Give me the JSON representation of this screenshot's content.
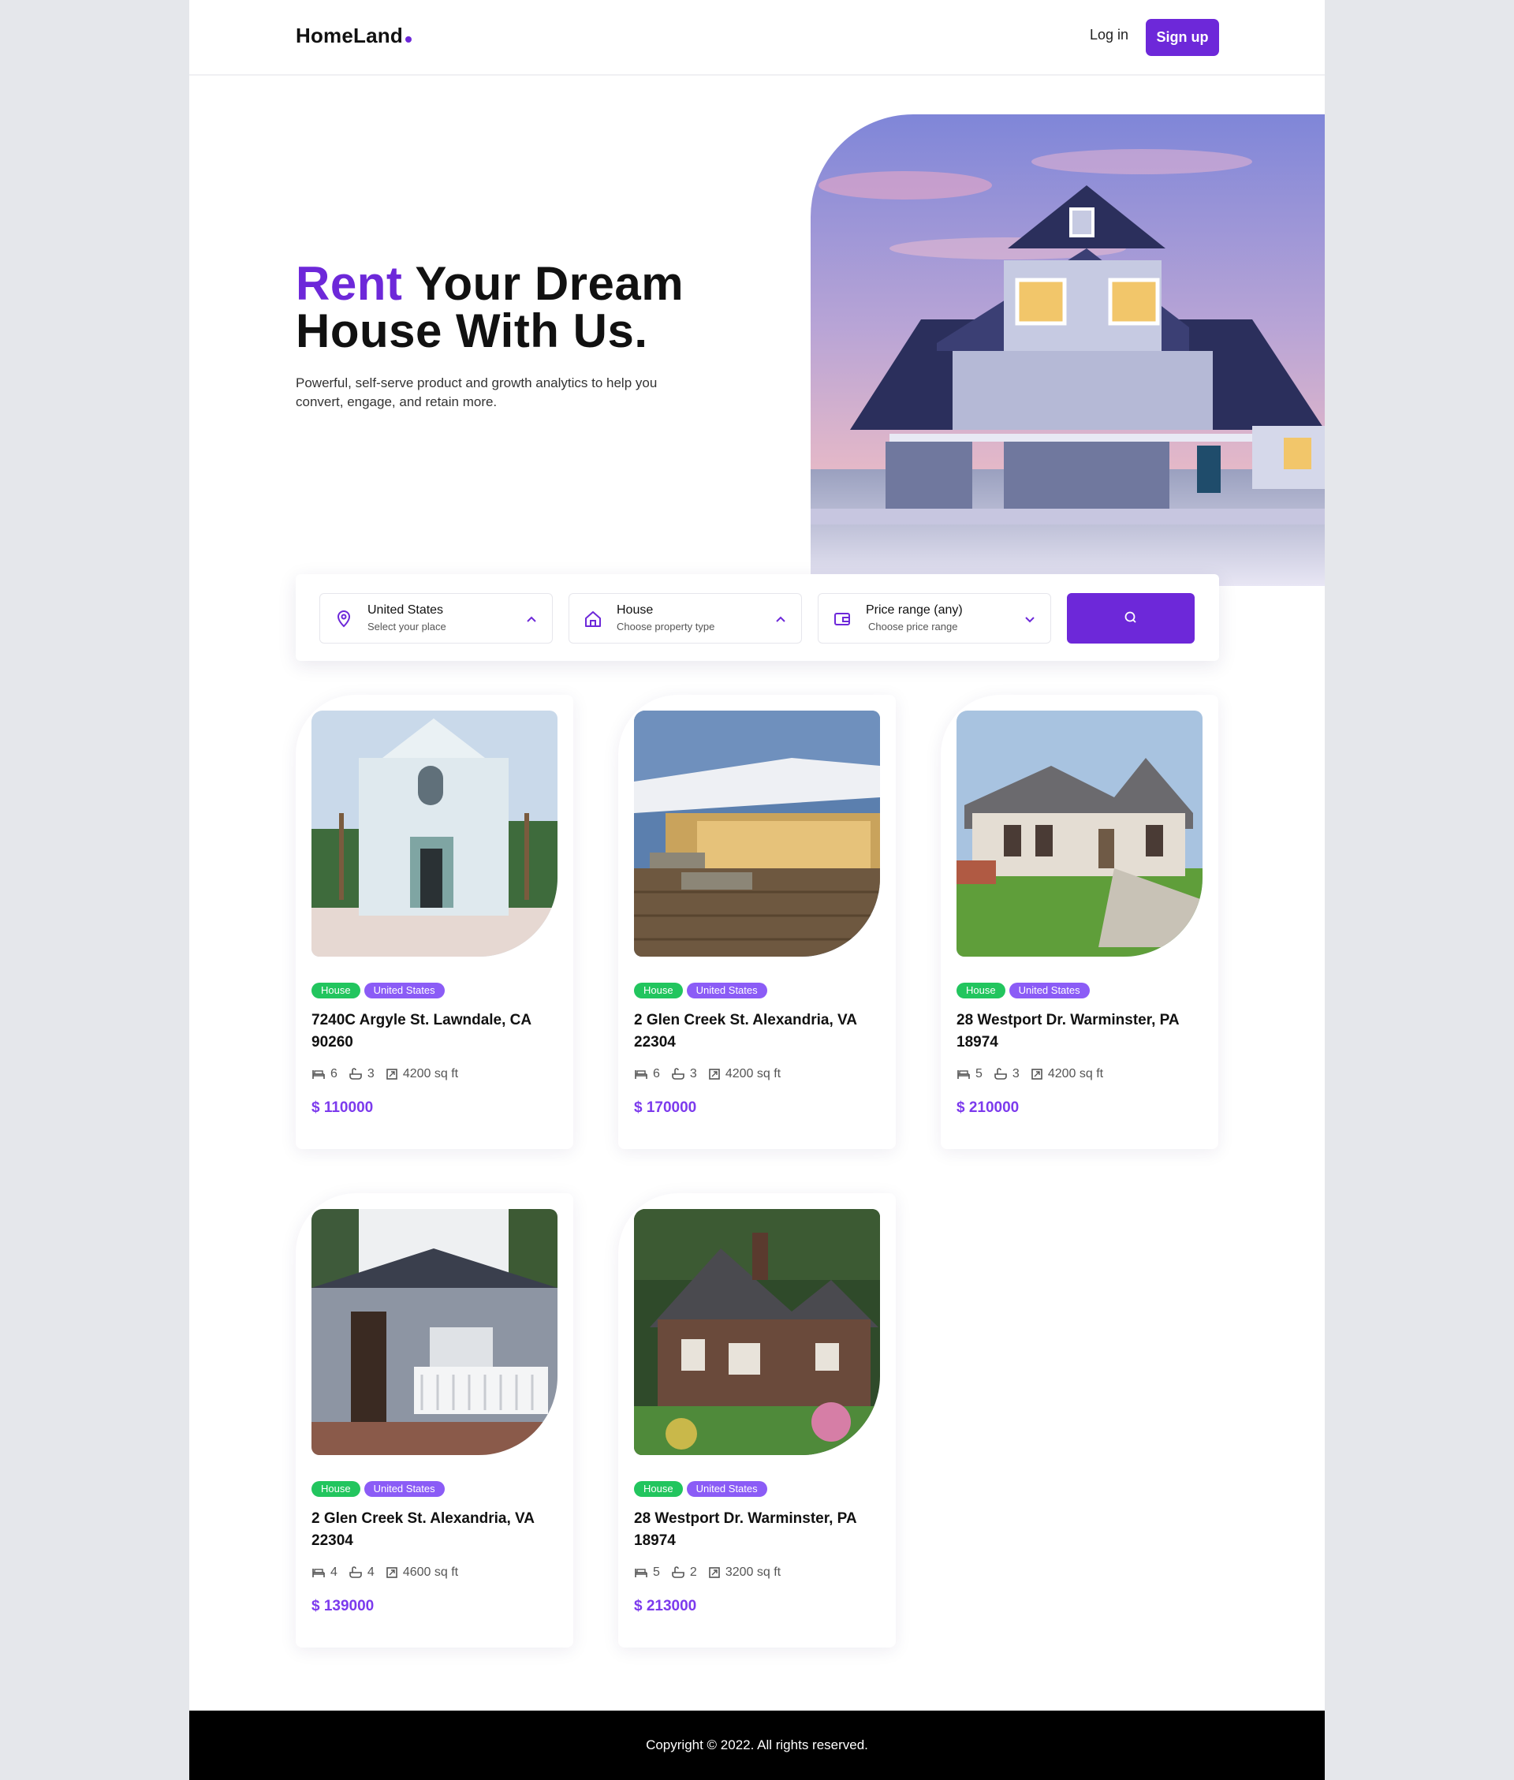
{
  "header": {
    "logo": "HomeLand",
    "login_label": "Log in",
    "signup_label": "Sign up"
  },
  "hero": {
    "title_accent": "Rent",
    "title_rest_line1": " Your Dream",
    "title_line2": "House With Us.",
    "subtitle": "Powerful, self-serve product and growth analytics to help you convert, engage, and retain more."
  },
  "search": {
    "location": {
      "title": "United States",
      "sub": "Select your place",
      "icon": "location-pin-icon"
    },
    "type": {
      "title": "House",
      "sub": "Choose property type",
      "icon": "house-icon"
    },
    "price": {
      "title": "Price range (any)",
      "sub": "Choose price range",
      "icon": "wallet-icon"
    },
    "button_icon": "search-icon"
  },
  "listings": [
    {
      "tag_type": "House",
      "tag_country": "United States",
      "address": "7240C Argyle St. Lawndale, CA 90260",
      "beds": "6",
      "baths": "3",
      "area": "4200 sq ft",
      "price": "$ 110000"
    },
    {
      "tag_type": "House",
      "tag_country": "United States",
      "address": "2 Glen Creek St. Alexandria, VA 22304",
      "beds": "6",
      "baths": "3",
      "area": "4200 sq ft",
      "price": "$ 170000"
    },
    {
      "tag_type": "House",
      "tag_country": "United States",
      "address": "28 Westport Dr. Warminster, PA 18974",
      "beds": "5",
      "baths": "3",
      "area": "4200 sq ft",
      "price": "$ 210000"
    },
    {
      "tag_type": "House",
      "tag_country": "United States",
      "address": "2 Glen Creek St. Alexandria, VA 22304",
      "beds": "4",
      "baths": "4",
      "area": "4600 sq ft",
      "price": "$ 139000"
    },
    {
      "tag_type": "House",
      "tag_country": "United States",
      "address": "28 Westport Dr. Warminster, PA 18974",
      "beds": "5",
      "baths": "2",
      "area": "3200 sq ft",
      "price": "$ 213000"
    }
  ],
  "footer": {
    "copyright": "Copyright © 2022. All rights reserved."
  },
  "colors": {
    "brand": "#6d28d9",
    "tag_green": "#22c55e",
    "tag_purple": "#8b5cf6",
    "price": "#7c3aed",
    "footer_bg": "#000000"
  }
}
